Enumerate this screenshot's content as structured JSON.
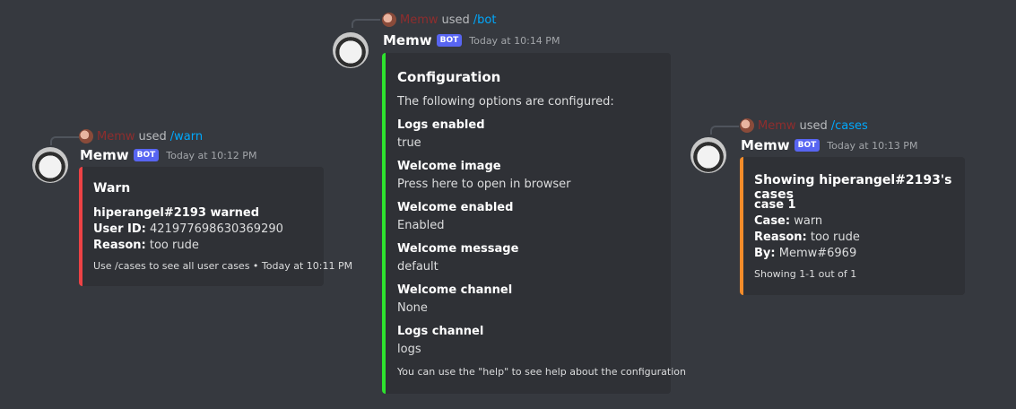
{
  "messages": [
    {
      "reply": {
        "user": "Memw",
        "used": "used",
        "command": "/warn"
      },
      "author": "Memw",
      "tag": "BOT",
      "timestamp": "Today at 10:12 PM",
      "embed": {
        "color": "#ed4245",
        "title": "Warn",
        "subtitle": "hiperangel#2193 warned",
        "user_id_label": "User ID:",
        "user_id": "421977698630369290",
        "reason_label": "Reason:",
        "reason": "too rude",
        "footer": "Use /cases to see all user cases • Today at 10:11 PM"
      }
    },
    {
      "reply": {
        "user": "Memw",
        "used": "used",
        "command": "/bot"
      },
      "author": "Memw",
      "tag": "BOT",
      "timestamp": "Today at 10:14 PM",
      "embed": {
        "color": "#2ee22e",
        "title": "Configuration",
        "description": "The following options are configured:",
        "fields": [
          {
            "name": "Logs enabled",
            "value": "true"
          },
          {
            "name": "Welcome image",
            "value": "Press here to open in browser"
          },
          {
            "name": "Welcome enabled",
            "value": "Enabled"
          },
          {
            "name": "Welcome message",
            "value": "default"
          },
          {
            "name": "Welcome channel",
            "value": "None"
          },
          {
            "name": "Logs channel",
            "value": "logs"
          }
        ],
        "footer": "You can use the \"help\" to see help about the configuration"
      }
    },
    {
      "reply": {
        "user": "Memw",
        "used": "used",
        "command": "/cases"
      },
      "author": "Memw",
      "tag": "BOT",
      "timestamp": "Today at 10:13 PM",
      "embed": {
        "color": "#f48c2a",
        "title": "Showing hiperangel#2193's cases",
        "case_title": "case 1",
        "case_label": "Case:",
        "case": "warn",
        "reason_label": "Reason:",
        "reason": "too rude",
        "by_label": "By:",
        "by": "Memw#6969",
        "footer": "Showing 1-1 out of 1"
      }
    }
  ]
}
